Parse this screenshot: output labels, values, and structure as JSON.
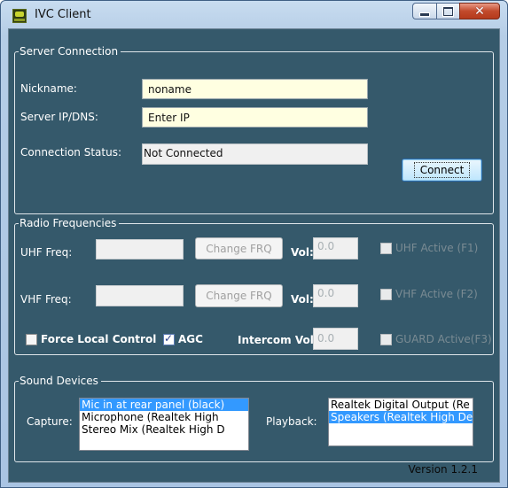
{
  "window": {
    "title": "IVC Client"
  },
  "server": {
    "legend": "Server Connection",
    "nickname_label": "Nickname:",
    "nickname_value": "noname",
    "server_label": "Server IP/DNS:",
    "server_value": "Enter IP",
    "status_label": "Connection Status:",
    "status_value": "Not Connected",
    "connect_label": "Connect"
  },
  "radio": {
    "legend": "Radio Frequencies",
    "uhf_label": "UHF Freq:",
    "uhf_value": "",
    "uhf_change": "Change FRQ",
    "uhf_vol_label": "Vol:",
    "uhf_vol_value": "0.0",
    "uhf_active_label": "UHF Active (F1)",
    "vhf_label": "VHF Freq:",
    "vhf_value": "",
    "vhf_change": "Change FRQ",
    "vhf_vol_label": "Vol:",
    "vhf_vol_value": "0.0",
    "vhf_active_label": "VHF Active (F2)",
    "force_local_label": "Force Local Control",
    "force_local_checked": false,
    "agc_label": "AGC",
    "agc_checked": true,
    "intercom_label": "Intercom Vol:",
    "intercom_value": "0.0",
    "guard_label": "GUARD Active(F3)"
  },
  "sound": {
    "legend": "Sound Devices",
    "capture_label": "Capture:",
    "capture_items": [
      "Mic in at rear panel (black)",
      "Microphone (Realtek High",
      "Stereo Mix (Realtek High D"
    ],
    "capture_selected": 0,
    "playback_label": "Playback:",
    "playback_items": [
      "Realtek Digital Output (Re",
      "Speakers (Realtek High De"
    ],
    "playback_selected": 1
  },
  "footer": {
    "version": "Version 1.2.1"
  }
}
